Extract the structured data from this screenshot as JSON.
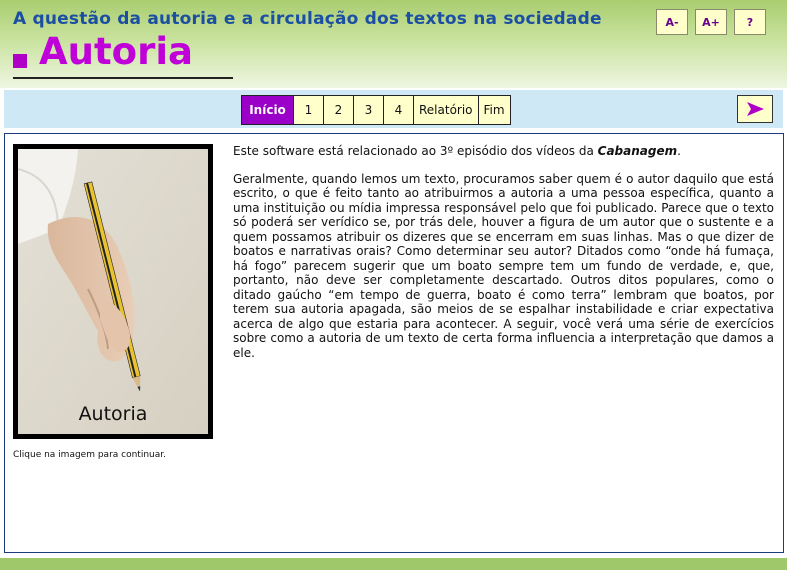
{
  "header": {
    "subtitle": "A questão da autoria e a circulação dos textos na sociedade",
    "title": "Autoria",
    "buttons": {
      "font_decrease": "A-",
      "font_increase": "A+",
      "help": "?"
    }
  },
  "nav": {
    "items": [
      {
        "label": "Início",
        "active": true
      },
      {
        "label": "1"
      },
      {
        "label": "2"
      },
      {
        "label": "3"
      },
      {
        "label": "4"
      },
      {
        "label": "Relatório"
      },
      {
        "label": "Fim"
      }
    ],
    "next_icon": "right-arrow-icon"
  },
  "main": {
    "image_label": "Autoria",
    "image_caption": "Clique na imagem para continuar.",
    "intro_prefix": "Este software está relacionado ao 3º episódio dos vídeos da ",
    "intro_emphasis": "Cabanagem",
    "intro_suffix": ".",
    "paragraph": "Geralmente, quando lemos um texto, procuramos saber quem é o autor daquilo que está escrito, o que é feito tanto ao atribuirmos a autoria a uma pessoa específica, quanto a uma instituição ou mídia impressa responsável pelo que foi publicado. Parece que o texto só poderá ser verídico se, por trás dele, houver a figura de um autor que o sustente e a quem possamos atribuir os dizeres que se encerram em suas linhas. Mas o que dizer de boatos e narrativas orais? Como determinar seu autor? Ditados como “onde há fumaça, há fogo” parecem sugerir que um boato sempre tem um fundo de verdade, e, que, portanto, não deve ser completamente descartado. Outros ditos populares, como o ditado gaúcho “em tempo de guerra, boato é como terra” lembram que boatos, por terem sua autoria apagada, são meios de se espalhar instabilidade e criar expectativa acerca de algo que estaria para acontecer. A seguir, você verá uma série de exercícios sobre como a autoria de um texto de certa forma influencia a interpretação que damos a ele."
  },
  "colors": {
    "accent": "#c000d8",
    "nav_active": "#9a00c8",
    "button_bg": "#ffffcc",
    "header_text": "#1a4fa3"
  }
}
